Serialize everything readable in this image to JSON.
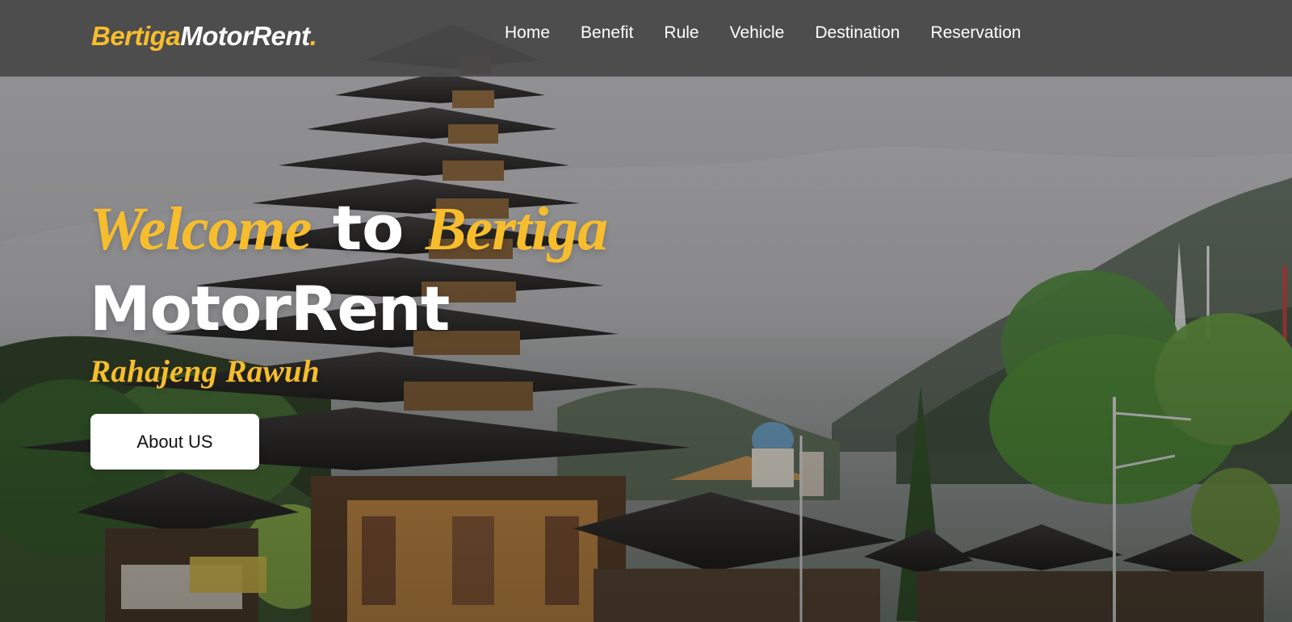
{
  "brand": {
    "part1": "Bertiga",
    "part2": "MotorRent",
    "part3": "."
  },
  "nav": [
    {
      "label": "Home"
    },
    {
      "label": "Benefit"
    },
    {
      "label": "Rule"
    },
    {
      "label": "Vehicle"
    },
    {
      "label": "Destination"
    },
    {
      "label": "Reservation"
    }
  ],
  "hero": {
    "headline_word_1": "Welcome",
    "headline_word_2": "to",
    "headline_word_3": "Bertiga",
    "headline_line_2": "MotorRent",
    "tagline": "Rahajeng Rawuh",
    "button_label": "About US"
  },
  "colors": {
    "accent": "#f7bd2d",
    "nav_background": "#484848",
    "button_background": "#ffffff",
    "primary_text": "#ffffff"
  }
}
